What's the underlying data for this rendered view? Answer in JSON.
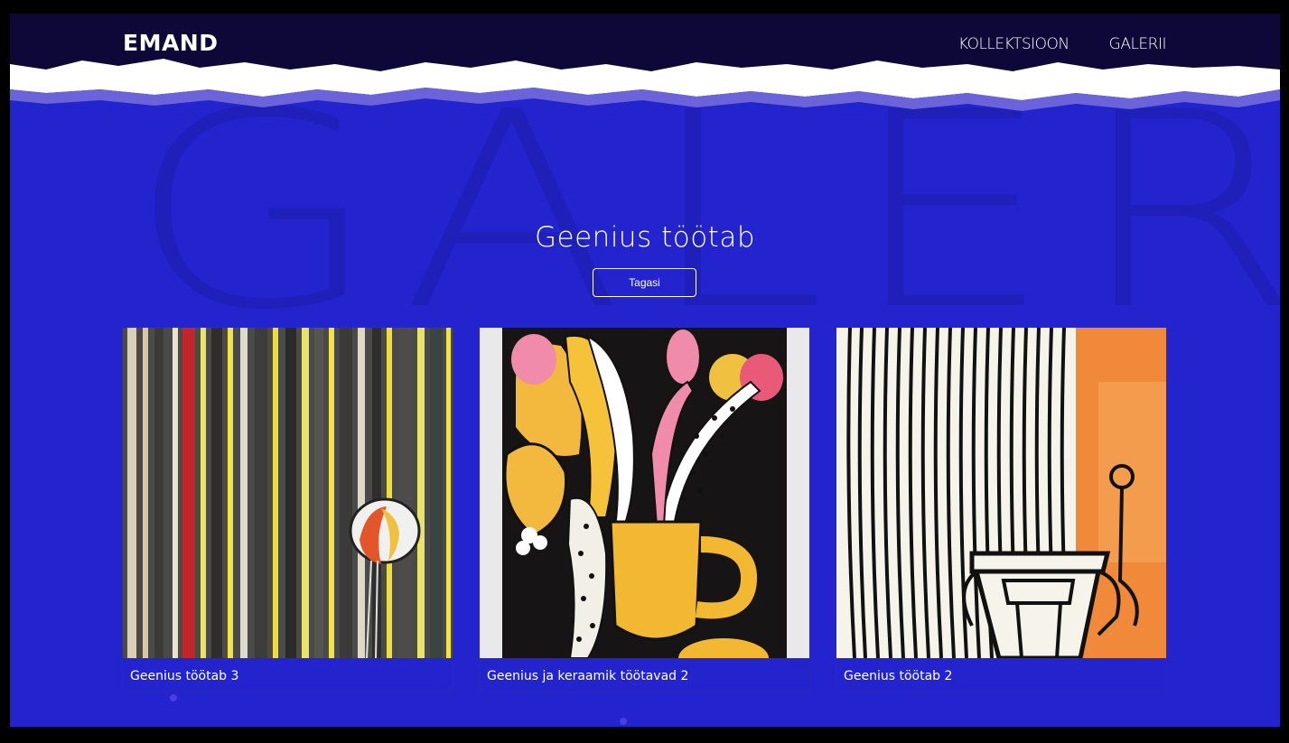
{
  "header": {
    "logo": "EMAND",
    "nav": [
      "KOLLEKTSIOON",
      "GALERII"
    ]
  },
  "background_word": "GALERII",
  "page": {
    "title": "Geenius töötab",
    "back_label": "Tagasi"
  },
  "gallery": [
    {
      "title": "Geenius töötab 3"
    },
    {
      "title": "Geenius ja keraamik töötavad 2"
    },
    {
      "title": "Geenius töötab 2"
    }
  ],
  "colors": {
    "page_bg": "#2424cf",
    "header_bg": "#0e0838",
    "text": "#ffffff"
  }
}
